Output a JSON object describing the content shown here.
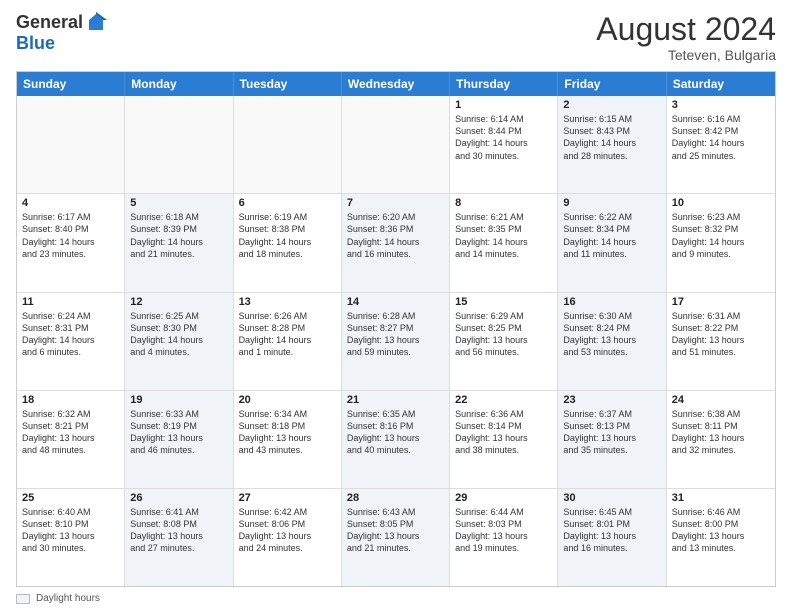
{
  "header": {
    "logo_line1": "General",
    "logo_line2": "Blue",
    "month_year": "August 2024",
    "location": "Teteven, Bulgaria"
  },
  "weekdays": [
    "Sunday",
    "Monday",
    "Tuesday",
    "Wednesday",
    "Thursday",
    "Friday",
    "Saturday"
  ],
  "weeks": [
    [
      {
        "day": "",
        "info": "",
        "shaded": false,
        "empty": true
      },
      {
        "day": "",
        "info": "",
        "shaded": false,
        "empty": true
      },
      {
        "day": "",
        "info": "",
        "shaded": false,
        "empty": true
      },
      {
        "day": "",
        "info": "",
        "shaded": false,
        "empty": true
      },
      {
        "day": "1",
        "info": "Sunrise: 6:14 AM\nSunset: 8:44 PM\nDaylight: 14 hours\nand 30 minutes.",
        "shaded": false,
        "empty": false
      },
      {
        "day": "2",
        "info": "Sunrise: 6:15 AM\nSunset: 8:43 PM\nDaylight: 14 hours\nand 28 minutes.",
        "shaded": true,
        "empty": false
      },
      {
        "day": "3",
        "info": "Sunrise: 6:16 AM\nSunset: 8:42 PM\nDaylight: 14 hours\nand 25 minutes.",
        "shaded": false,
        "empty": false
      }
    ],
    [
      {
        "day": "4",
        "info": "Sunrise: 6:17 AM\nSunset: 8:40 PM\nDaylight: 14 hours\nand 23 minutes.",
        "shaded": false,
        "empty": false
      },
      {
        "day": "5",
        "info": "Sunrise: 6:18 AM\nSunset: 8:39 PM\nDaylight: 14 hours\nand 21 minutes.",
        "shaded": true,
        "empty": false
      },
      {
        "day": "6",
        "info": "Sunrise: 6:19 AM\nSunset: 8:38 PM\nDaylight: 14 hours\nand 18 minutes.",
        "shaded": false,
        "empty": false
      },
      {
        "day": "7",
        "info": "Sunrise: 6:20 AM\nSunset: 8:36 PM\nDaylight: 14 hours\nand 16 minutes.",
        "shaded": true,
        "empty": false
      },
      {
        "day": "8",
        "info": "Sunrise: 6:21 AM\nSunset: 8:35 PM\nDaylight: 14 hours\nand 14 minutes.",
        "shaded": false,
        "empty": false
      },
      {
        "day": "9",
        "info": "Sunrise: 6:22 AM\nSunset: 8:34 PM\nDaylight: 14 hours\nand 11 minutes.",
        "shaded": true,
        "empty": false
      },
      {
        "day": "10",
        "info": "Sunrise: 6:23 AM\nSunset: 8:32 PM\nDaylight: 14 hours\nand 9 minutes.",
        "shaded": false,
        "empty": false
      }
    ],
    [
      {
        "day": "11",
        "info": "Sunrise: 6:24 AM\nSunset: 8:31 PM\nDaylight: 14 hours\nand 6 minutes.",
        "shaded": false,
        "empty": false
      },
      {
        "day": "12",
        "info": "Sunrise: 6:25 AM\nSunset: 8:30 PM\nDaylight: 14 hours\nand 4 minutes.",
        "shaded": true,
        "empty": false
      },
      {
        "day": "13",
        "info": "Sunrise: 6:26 AM\nSunset: 8:28 PM\nDaylight: 14 hours\nand 1 minute.",
        "shaded": false,
        "empty": false
      },
      {
        "day": "14",
        "info": "Sunrise: 6:28 AM\nSunset: 8:27 PM\nDaylight: 13 hours\nand 59 minutes.",
        "shaded": true,
        "empty": false
      },
      {
        "day": "15",
        "info": "Sunrise: 6:29 AM\nSunset: 8:25 PM\nDaylight: 13 hours\nand 56 minutes.",
        "shaded": false,
        "empty": false
      },
      {
        "day": "16",
        "info": "Sunrise: 6:30 AM\nSunset: 8:24 PM\nDaylight: 13 hours\nand 53 minutes.",
        "shaded": true,
        "empty": false
      },
      {
        "day": "17",
        "info": "Sunrise: 6:31 AM\nSunset: 8:22 PM\nDaylight: 13 hours\nand 51 minutes.",
        "shaded": false,
        "empty": false
      }
    ],
    [
      {
        "day": "18",
        "info": "Sunrise: 6:32 AM\nSunset: 8:21 PM\nDaylight: 13 hours\nand 48 minutes.",
        "shaded": false,
        "empty": false
      },
      {
        "day": "19",
        "info": "Sunrise: 6:33 AM\nSunset: 8:19 PM\nDaylight: 13 hours\nand 46 minutes.",
        "shaded": true,
        "empty": false
      },
      {
        "day": "20",
        "info": "Sunrise: 6:34 AM\nSunset: 8:18 PM\nDaylight: 13 hours\nand 43 minutes.",
        "shaded": false,
        "empty": false
      },
      {
        "day": "21",
        "info": "Sunrise: 6:35 AM\nSunset: 8:16 PM\nDaylight: 13 hours\nand 40 minutes.",
        "shaded": true,
        "empty": false
      },
      {
        "day": "22",
        "info": "Sunrise: 6:36 AM\nSunset: 8:14 PM\nDaylight: 13 hours\nand 38 minutes.",
        "shaded": false,
        "empty": false
      },
      {
        "day": "23",
        "info": "Sunrise: 6:37 AM\nSunset: 8:13 PM\nDaylight: 13 hours\nand 35 minutes.",
        "shaded": true,
        "empty": false
      },
      {
        "day": "24",
        "info": "Sunrise: 6:38 AM\nSunset: 8:11 PM\nDaylight: 13 hours\nand 32 minutes.",
        "shaded": false,
        "empty": false
      }
    ],
    [
      {
        "day": "25",
        "info": "Sunrise: 6:40 AM\nSunset: 8:10 PM\nDaylight: 13 hours\nand 30 minutes.",
        "shaded": false,
        "empty": false
      },
      {
        "day": "26",
        "info": "Sunrise: 6:41 AM\nSunset: 8:08 PM\nDaylight: 13 hours\nand 27 minutes.",
        "shaded": true,
        "empty": false
      },
      {
        "day": "27",
        "info": "Sunrise: 6:42 AM\nSunset: 8:06 PM\nDaylight: 13 hours\nand 24 minutes.",
        "shaded": false,
        "empty": false
      },
      {
        "day": "28",
        "info": "Sunrise: 6:43 AM\nSunset: 8:05 PM\nDaylight: 13 hours\nand 21 minutes.",
        "shaded": true,
        "empty": false
      },
      {
        "day": "29",
        "info": "Sunrise: 6:44 AM\nSunset: 8:03 PM\nDaylight: 13 hours\nand 19 minutes.",
        "shaded": false,
        "empty": false
      },
      {
        "day": "30",
        "info": "Sunrise: 6:45 AM\nSunset: 8:01 PM\nDaylight: 13 hours\nand 16 minutes.",
        "shaded": true,
        "empty": false
      },
      {
        "day": "31",
        "info": "Sunrise: 6:46 AM\nSunset: 8:00 PM\nDaylight: 13 hours\nand 13 minutes.",
        "shaded": false,
        "empty": false
      }
    ]
  ],
  "footer": {
    "shaded_label": "Daylight hours"
  }
}
